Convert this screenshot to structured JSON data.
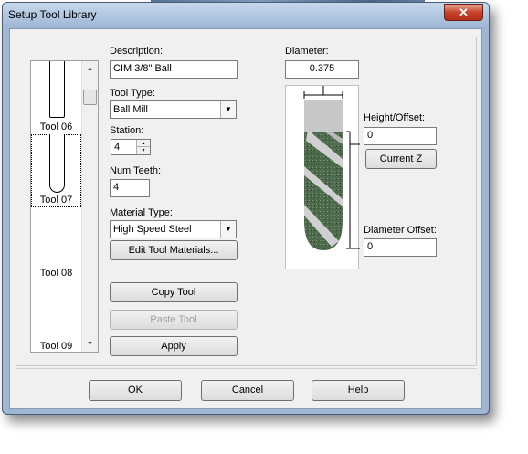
{
  "window": {
    "title": "Setup Tool Library",
    "close_glyph": "✕"
  },
  "tools": [
    {
      "label": "Tool 06",
      "shape": "square"
    },
    {
      "label": "Tool 07",
      "shape": "ball"
    },
    {
      "label": "Tool 08",
      "shape": "none"
    },
    {
      "label": "Tool 09",
      "shape": "none"
    }
  ],
  "fields": {
    "description_label": "Description:",
    "description_value": "CIM 3/8\" Ball",
    "tool_type_label": "Tool Type:",
    "tool_type_value": "Ball Mill",
    "station_label": "Station:",
    "station_value": "4",
    "num_teeth_label": "Num Teeth:",
    "num_teeth_value": "4",
    "material_type_label": "Material Type:",
    "material_type_value": "High Speed Steel",
    "diameter_label": "Diameter:",
    "diameter_value": "0.375",
    "height_offset_label": "Height/Offset:",
    "height_offset_value": "0",
    "diameter_offset_label": "Diameter Offset:",
    "diameter_offset_value": "0"
  },
  "buttons": {
    "edit_materials": "Edit Tool Materials...",
    "copy_tool": "Copy Tool",
    "paste_tool": "Paste Tool",
    "apply": "Apply",
    "current_z": "Current Z",
    "ok": "OK",
    "cancel": "Cancel",
    "help": "Help"
  },
  "icons": {
    "drop_glyph": "▼",
    "up_glyph": "▲",
    "down_glyph": "▼"
  },
  "colors": {
    "flute": "#4d6a4c",
    "shank": "#c8c8c8",
    "close_red": "#c7432b"
  }
}
